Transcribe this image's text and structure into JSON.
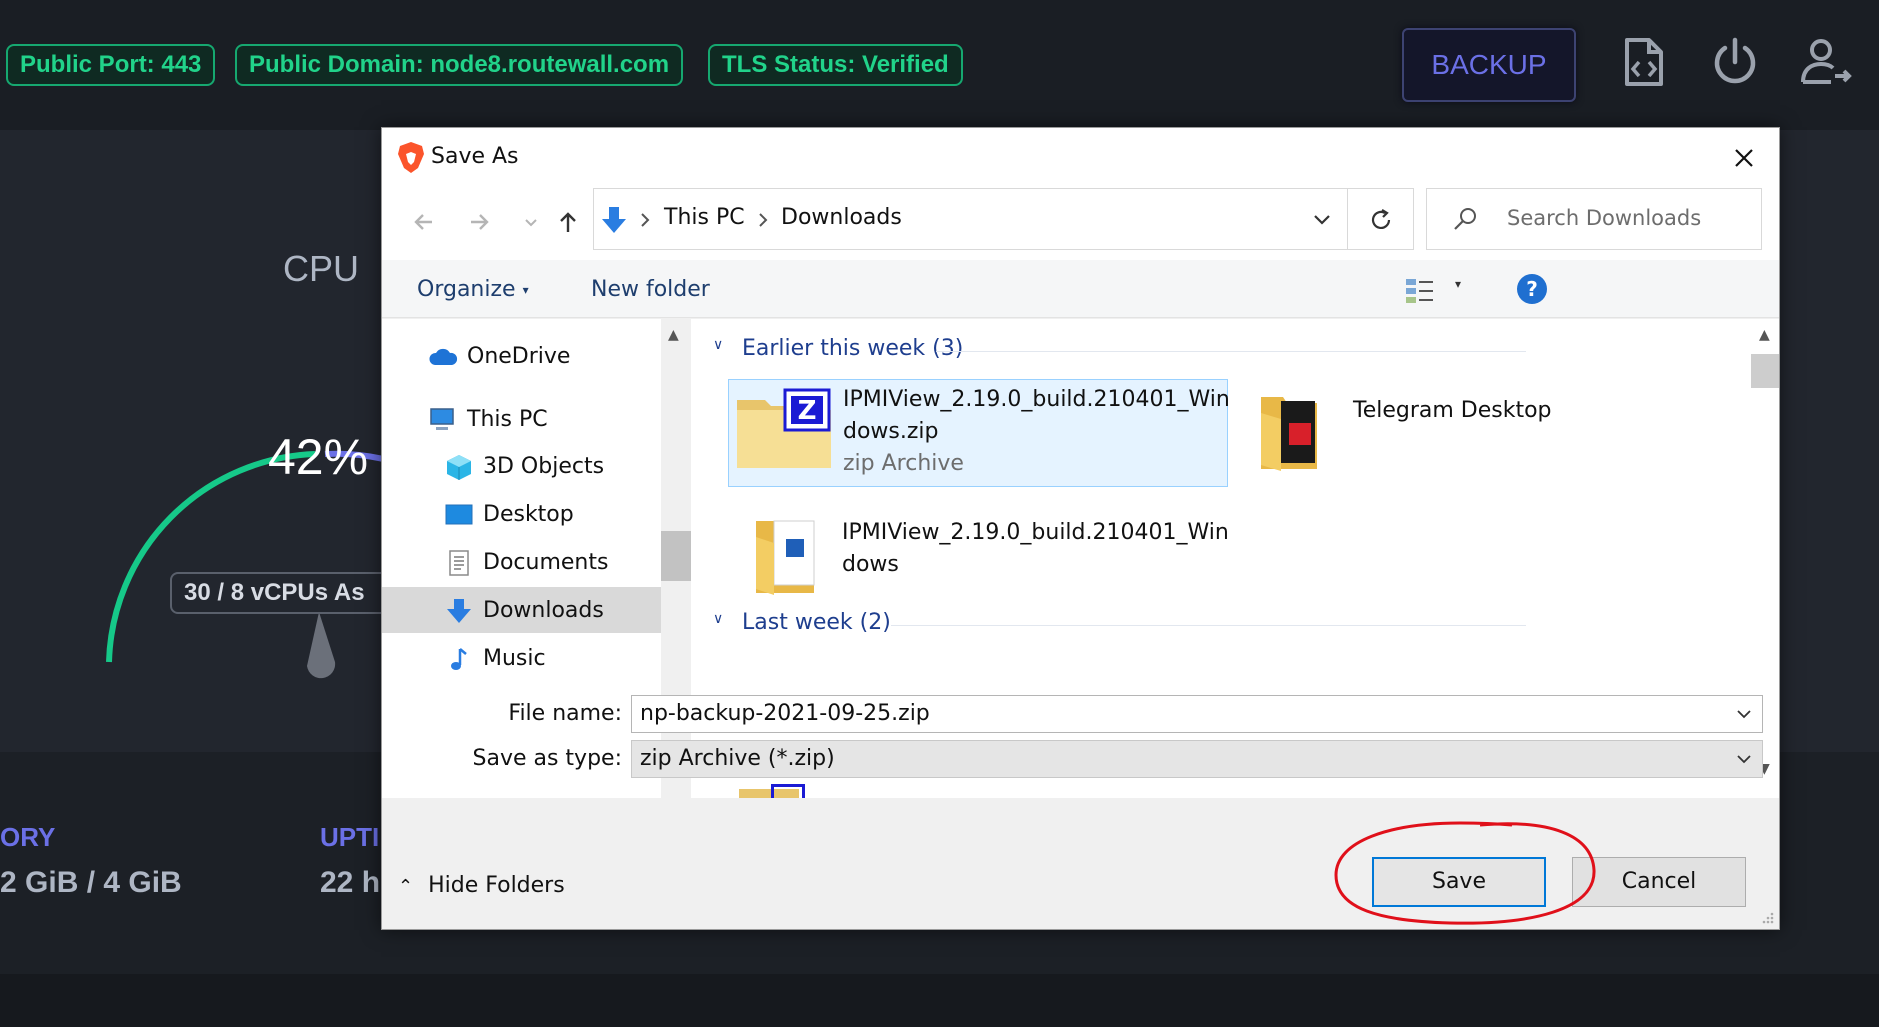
{
  "dashboard": {
    "pills": [
      "Public Port: 443",
      "Public Domain: node8.routewall.com",
      "TLS Status: Verified"
    ],
    "backup_label": "BACKUP",
    "icons": [
      "code-file-icon",
      "power-icon",
      "user-logout-icon"
    ],
    "cpu": {
      "title": "CPU",
      "value": "42%",
      "vcpus": "30 / 8 vCPUs As"
    },
    "stats": [
      {
        "label": "ORY",
        "value": "2 GiB / 4 GiB"
      },
      {
        "label": "UPTI",
        "value": "22 h"
      }
    ],
    "colors": {
      "accent_green": "#21d38a",
      "accent_blue": "#6b70e6"
    }
  },
  "dialog": {
    "title": "Save As",
    "breadcrumb": [
      "This PC",
      "Downloads"
    ],
    "search_placeholder": "Search Downloads",
    "toolbar": {
      "organize": "Organize",
      "new_folder": "New folder"
    },
    "tree": [
      "OneDrive",
      "This PC",
      "3D Objects",
      "Desktop",
      "Documents",
      "Downloads",
      "Music"
    ],
    "selected_folder": "Downloads",
    "groups": [
      {
        "title": "Earlier this week",
        "count": "(3)",
        "items": [
          {
            "name_line1": "IPMIView_2.19.0_build.210401_Win",
            "name_line2": "dows.zip",
            "type": "zip Archive"
          },
          {
            "name_line1": "Telegram Desktop",
            "name_line2": "",
            "type": ""
          },
          {
            "name_line1": "IPMIView_2.19.0_build.210401_Win",
            "name_line2": "dows",
            "type": ""
          }
        ]
      },
      {
        "title": "Last week",
        "count": "(2)",
        "items": []
      }
    ],
    "file_name_label": "File name:",
    "file_name_value": "np-backup-2021-09-25.zip",
    "save_type_label": "Save as type:",
    "save_type_value": "zip Archive (*.zip)",
    "hide_folders": "Hide Folders",
    "save_button": "Save",
    "cancel_button": "Cancel",
    "annotation_color": "#e0101a"
  }
}
